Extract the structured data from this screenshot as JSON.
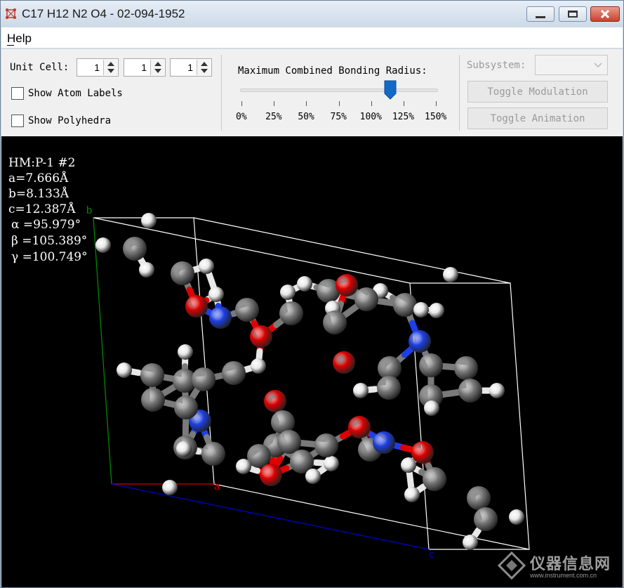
{
  "window": {
    "title": "C17 H12 N2 O4 - 02-094-1952"
  },
  "menu": {
    "items": [
      "Help"
    ]
  },
  "unit_cell": {
    "label": "Unit Cell:",
    "values": [
      "1",
      "1",
      "1"
    ]
  },
  "options": {
    "show_atom_labels": "Show Atom Labels",
    "show_polyhedra": "Show Polyhedra"
  },
  "bonding": {
    "label": "Maximum Combined Bonding Radius:",
    "ticks": [
      "0%",
      "25%",
      "50%",
      "75%",
      "100%",
      "125%",
      "150%"
    ],
    "value_percent": 115
  },
  "subsystem": {
    "label": "Subsystem:",
    "value": ""
  },
  "buttons": {
    "toggle_modulation": "Toggle Modulation",
    "toggle_animation": "Toggle Animation"
  },
  "cell_info": {
    "space_group": "HM:P-1 #2",
    "a": "a=7.666Å",
    "b": "b=8.133Å",
    "c": "c=12.387Å",
    "alpha": "α =95.979°",
    "beta": "β =105.389°",
    "gamma": "γ =100.749°"
  },
  "axes": {
    "a": "a",
    "b": "b",
    "c": "c"
  },
  "colors": {
    "carbon": "#7a7a7a",
    "hydrogen": "#e8e8e8",
    "oxygen": "#e00000",
    "nitrogen": "#1d3fe6",
    "axis_a": "#d00000",
    "axis_b": "#008800",
    "axis_c": "#0000cc",
    "cell": "#ffffff"
  },
  "watermark": {
    "main": "仪器信息网",
    "sub": "www.instrument.com.cn"
  }
}
